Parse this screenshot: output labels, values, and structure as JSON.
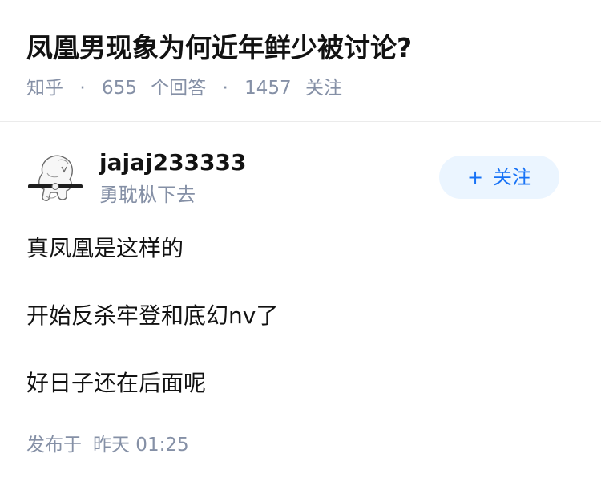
{
  "question": {
    "title": "凤凰男现象为何近年鲜少被讨论?",
    "source": "知乎",
    "separator": "·",
    "answers_count": "655",
    "answers_label": "个回答",
    "followers_count": "1457",
    "followers_label": "关注"
  },
  "author": {
    "name": "jajaj233333",
    "bio": "勇耽枞下去",
    "avatar_icon": "cartoon-avatar-icon",
    "follow_plus": "+",
    "follow_label": "关注"
  },
  "answer": {
    "paragraphs": [
      "真凤凰是这样的",
      "开始反杀牢登和底幻nv了",
      "好日子还在后面呢"
    ],
    "publish_label": "发布于",
    "publish_time": "昨天 01:25"
  },
  "colors": {
    "meta_gray": "#8590a6",
    "follow_bg": "#ebf5ff",
    "follow_text": "#1772f6"
  }
}
